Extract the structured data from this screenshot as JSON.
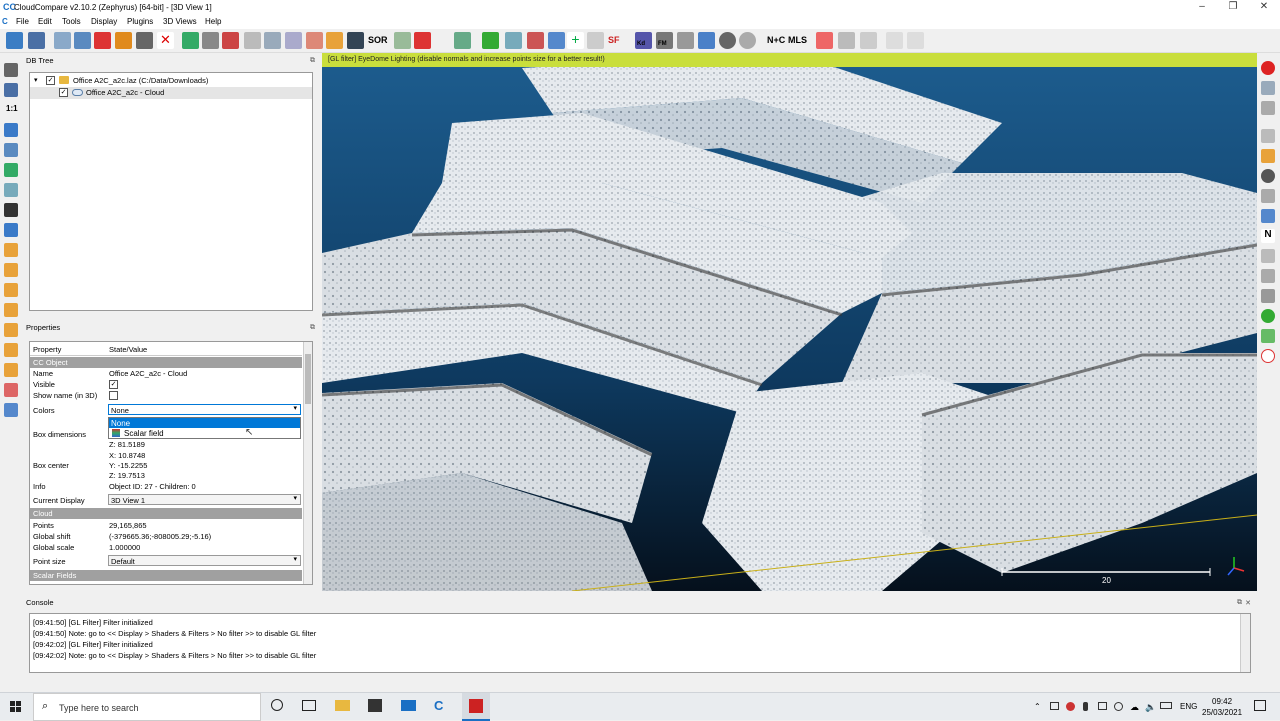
{
  "window": {
    "title": "CloudCompare v2.10.2 (Zephyrus) [64-bit] - [3D View 1]",
    "app_icon": "CC",
    "controls": [
      "–",
      "❐",
      "✕"
    ]
  },
  "menu": [
    "File",
    "Edit",
    "Tools",
    "Display",
    "Plugins",
    "3D Views",
    "Help"
  ],
  "toolbar": {
    "text_buttons": [
      "SOR",
      "SF",
      "Kd",
      "FM",
      "N+C",
      "MLS"
    ]
  },
  "left_toolbar": {
    "zoom_label": "1:1"
  },
  "db_tree": {
    "title": "DB Tree",
    "items": [
      {
        "label": "Office A2C_a2c.laz (C:/Data/Downloads)",
        "checked": true
      },
      {
        "label": "Office A2C_a2c - Cloud",
        "checked": true
      }
    ]
  },
  "properties": {
    "title": "Properties",
    "col_property": "Property",
    "col_value": "State/Value",
    "section_cc_object": "CC Object",
    "name_key": "Name",
    "name_val": "Office A2C_a2c - Cloud",
    "visible_key": "Visible",
    "showname_key": "Show name (in 3D)",
    "colors_key": "Colors",
    "colors_val": "None",
    "colors_options": [
      "None",
      "Scalar field"
    ],
    "boxdim_key": "Box dimensions",
    "boxdim_z": "Z: 81.5189",
    "boxcenter_key": "Box center",
    "boxcenter_x": "X: 10.8748",
    "boxcenter_y": "Y: -15.2255",
    "boxcenter_z": "Z: 19.7513",
    "info_key": "Info",
    "info_val": "Object ID: 27 - Children: 0",
    "display_key": "Current Display",
    "display_val": "3D View 1",
    "section_cloud": "Cloud",
    "points_key": "Points",
    "points_val": "29,165,865",
    "shift_key": "Global shift",
    "shift_val": "(-379665.36;-808005.29;-5.16)",
    "scale_key": "Global scale",
    "scale_val": "1.000000",
    "psize_key": "Point size",
    "psize_val": "Default",
    "section_sf": "Scalar Fields"
  },
  "view3d": {
    "banner": "[GL filter] EyeDome Lighting (disable normals and increase points size for a better result!)",
    "scale_label": "20",
    "colors": {
      "background": "#0d3558",
      "banner": "#c9de3c",
      "cloud": "#e8ecef"
    }
  },
  "console": {
    "title": "Console",
    "lines": [
      "[09:41:50] [GL Filter] Filter initialized",
      "[09:41:50] Note: go to << Display > Shaders & Filters > No filter >> to disable GL filter",
      "[09:42:02] [GL Filter] Filter initialized",
      "[09:42:02] Note: go to << Display > Shaders & Filters > No filter >> to disable GL filter"
    ]
  },
  "taskbar": {
    "search_placeholder": "Type here to search",
    "lang": "ENG",
    "time": "09:42",
    "date": "25/03/2021"
  }
}
